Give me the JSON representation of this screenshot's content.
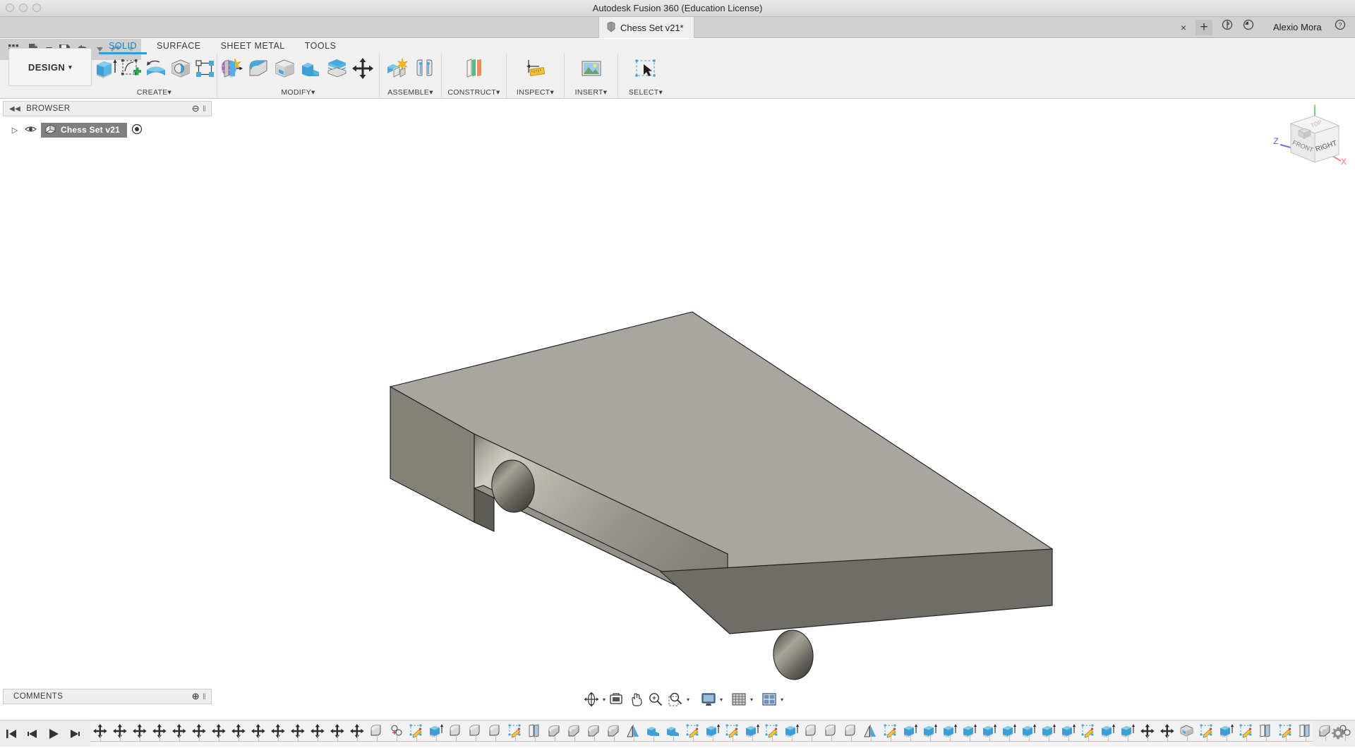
{
  "window": {
    "app_title": "Autodesk Fusion 360 (Education License)",
    "traffic_lights": [
      "close",
      "minimize",
      "zoom"
    ]
  },
  "tabbar": {
    "document_tab": "Chess Set v21*",
    "document_icon": "part-body-icon",
    "close_label": "×",
    "new_tab_label": "+",
    "icons": [
      {
        "name": "extension-icon",
        "glyph": "ɸ"
      },
      {
        "name": "job-status-icon",
        "glyph": "◔"
      },
      {
        "name": "help-icon",
        "glyph": "?"
      }
    ],
    "user_name": "Alexio Mora"
  },
  "quick_access": [
    {
      "name": "app-grid-icon",
      "label": "Show Data Panel"
    },
    {
      "name": "file-icon",
      "label": "File"
    },
    {
      "name": "file-dropdown-caret",
      "label": "File menu"
    },
    {
      "name": "save-icon",
      "label": "Save"
    },
    {
      "name": "undo-icon",
      "label": "Undo"
    },
    {
      "name": "undo-dropdown-caret",
      "label": "Undo history"
    },
    {
      "name": "redo-icon",
      "label": "Redo"
    },
    {
      "name": "redo-dropdown-caret",
      "label": "Redo history"
    }
  ],
  "workspace": {
    "selector_label": "DESIGN",
    "selector_caret": "▾"
  },
  "ribbon": {
    "tabs": [
      {
        "label": "SOLID",
        "active": true
      },
      {
        "label": "SURFACE",
        "active": false
      },
      {
        "label": "SHEET METAL",
        "active": false
      },
      {
        "label": "TOOLS",
        "active": false
      }
    ],
    "panels": [
      {
        "label": "CREATE",
        "caret": "▾",
        "tools": [
          {
            "name": "extrude-icon"
          },
          {
            "name": "create-sketch-icon"
          },
          {
            "name": "revolve-icon"
          },
          {
            "name": "sweep-icon"
          },
          {
            "name": "pattern-icon"
          },
          {
            "name": "form-icon"
          }
        ]
      },
      {
        "label": "MODIFY",
        "caret": "▾",
        "tools": [
          {
            "name": "press-pull-icon"
          },
          {
            "name": "fillet-icon"
          },
          {
            "name": "shell-icon"
          },
          {
            "name": "combine-icon"
          },
          {
            "name": "split-face-icon"
          },
          {
            "name": "move-copy-icon"
          }
        ]
      },
      {
        "label": "ASSEMBLE",
        "caret": "▾",
        "tools": [
          {
            "name": "new-component-icon"
          },
          {
            "name": "joint-icon"
          }
        ]
      },
      {
        "label": "CONSTRUCT",
        "caret": "▾",
        "tools": [
          {
            "name": "offset-plane-icon"
          }
        ]
      },
      {
        "label": "INSPECT",
        "caret": "▾",
        "tools": [
          {
            "name": "measure-icon"
          }
        ]
      },
      {
        "label": "INSERT",
        "caret": "▾",
        "tools": [
          {
            "name": "insert-decal-icon"
          }
        ]
      },
      {
        "label": "SELECT",
        "caret": "▾",
        "tools": [
          {
            "name": "select-window-icon"
          }
        ]
      }
    ]
  },
  "browser": {
    "title": "BROWSER",
    "collapse_icon": "◀◀",
    "minus_icon": "⊖",
    "grip_icon": "‖",
    "root_node": {
      "expand_icon": "▷",
      "visibility_icon": "◉",
      "type_icon": "document-icon",
      "label": "Chess Set v21",
      "target_icon": "◉",
      "selected": true
    }
  },
  "comments": {
    "title": "COMMENTS",
    "add_icon": "⊕",
    "grip_icon": "‖"
  },
  "navbar": {
    "tools": [
      {
        "name": "orbit-icon",
        "caret": "▾"
      },
      {
        "name": "look-at-icon",
        "caret": ""
      },
      {
        "name": "pan-icon",
        "caret": ""
      },
      {
        "name": "zoom-icon",
        "caret": ""
      },
      {
        "name": "zoom-window-icon",
        "caret": "▾"
      },
      {
        "name": "display-settings-icon",
        "caret": "▾"
      },
      {
        "name": "grid-snaps-icon",
        "caret": "▾"
      },
      {
        "name": "viewports-icon",
        "caret": "▾"
      }
    ]
  },
  "viewcube": {
    "front_face_label": "FRONT",
    "right_face_label": "RIGHT",
    "top_face_label": "TOP",
    "axes": [
      {
        "name": "x-axis",
        "label": "X",
        "color": "#f08a8a"
      },
      {
        "name": "y-axis",
        "label": "Y",
        "color": "#6fdc6f"
      },
      {
        "name": "z-axis",
        "label": "Z",
        "color": "#6f6fe8"
      }
    ]
  },
  "timeline": {
    "playback": [
      {
        "name": "go-to-beginning-icon"
      },
      {
        "name": "step-back-icon"
      },
      {
        "name": "play-icon"
      },
      {
        "name": "step-forward-icon"
      },
      {
        "name": "go-to-end-icon"
      }
    ],
    "features": [
      "move-copy-icon",
      "move-copy-icon",
      "move-copy-icon",
      "move-copy-icon",
      "move-copy-icon",
      "move-copy-icon",
      "move-copy-icon",
      "move-copy-icon",
      "move-copy-icon",
      "move-copy-icon",
      "move-copy-icon",
      "move-copy-icon",
      "move-copy-icon",
      "move-copy-icon",
      "revolve-icon",
      "hole-icon",
      "sketch-icon",
      "extrude-icon",
      "revolve-icon",
      "revolve-icon",
      "revolve-icon",
      "sketch-icon",
      "offset-plane-icon",
      "fillet-icon",
      "fillet-icon",
      "fillet-icon",
      "fillet-icon",
      "mirror-icon",
      "combine-icon",
      "combine-icon",
      "sketch-icon",
      "extrude-icon",
      "sketch-icon",
      "extrude-icon",
      "sketch-icon",
      "extrude-icon",
      "revolve-icon",
      "revolve-icon",
      "revolve-icon",
      "mirror-icon",
      "sketch-icon",
      "extrude-icon",
      "extrude-icon",
      "extrude-icon",
      "extrude-icon",
      "extrude-icon",
      "extrude-icon",
      "extrude-icon",
      "extrude-icon",
      "extrude-icon",
      "sketch-icon",
      "extrude-icon",
      "extrude-icon",
      "move-copy-icon",
      "move-copy-icon",
      "shell-icon",
      "sketch-icon",
      "extrude-icon",
      "sketch-icon",
      "offset-plane-icon",
      "sketch-icon",
      "offset-plane-icon",
      "fillet-icon",
      "hole-icon",
      "move-copy-icon",
      "combine-icon",
      "sketch-icon",
      "extrude-icon",
      "sketch-icon",
      "extrude-icon"
    ],
    "marker": {
      "name": "timeline-end-marker"
    },
    "settings_icon": "gear-icon"
  },
  "model": {
    "name": "l-bracket-body",
    "colors": {
      "top_face": "#a3a099",
      "front_face": "#6f6d67",
      "side_face": "#807e77",
      "slot_face": "#8d8b84",
      "hole_dark": "#4e4d48",
      "edge": "#2a2a2a"
    }
  }
}
